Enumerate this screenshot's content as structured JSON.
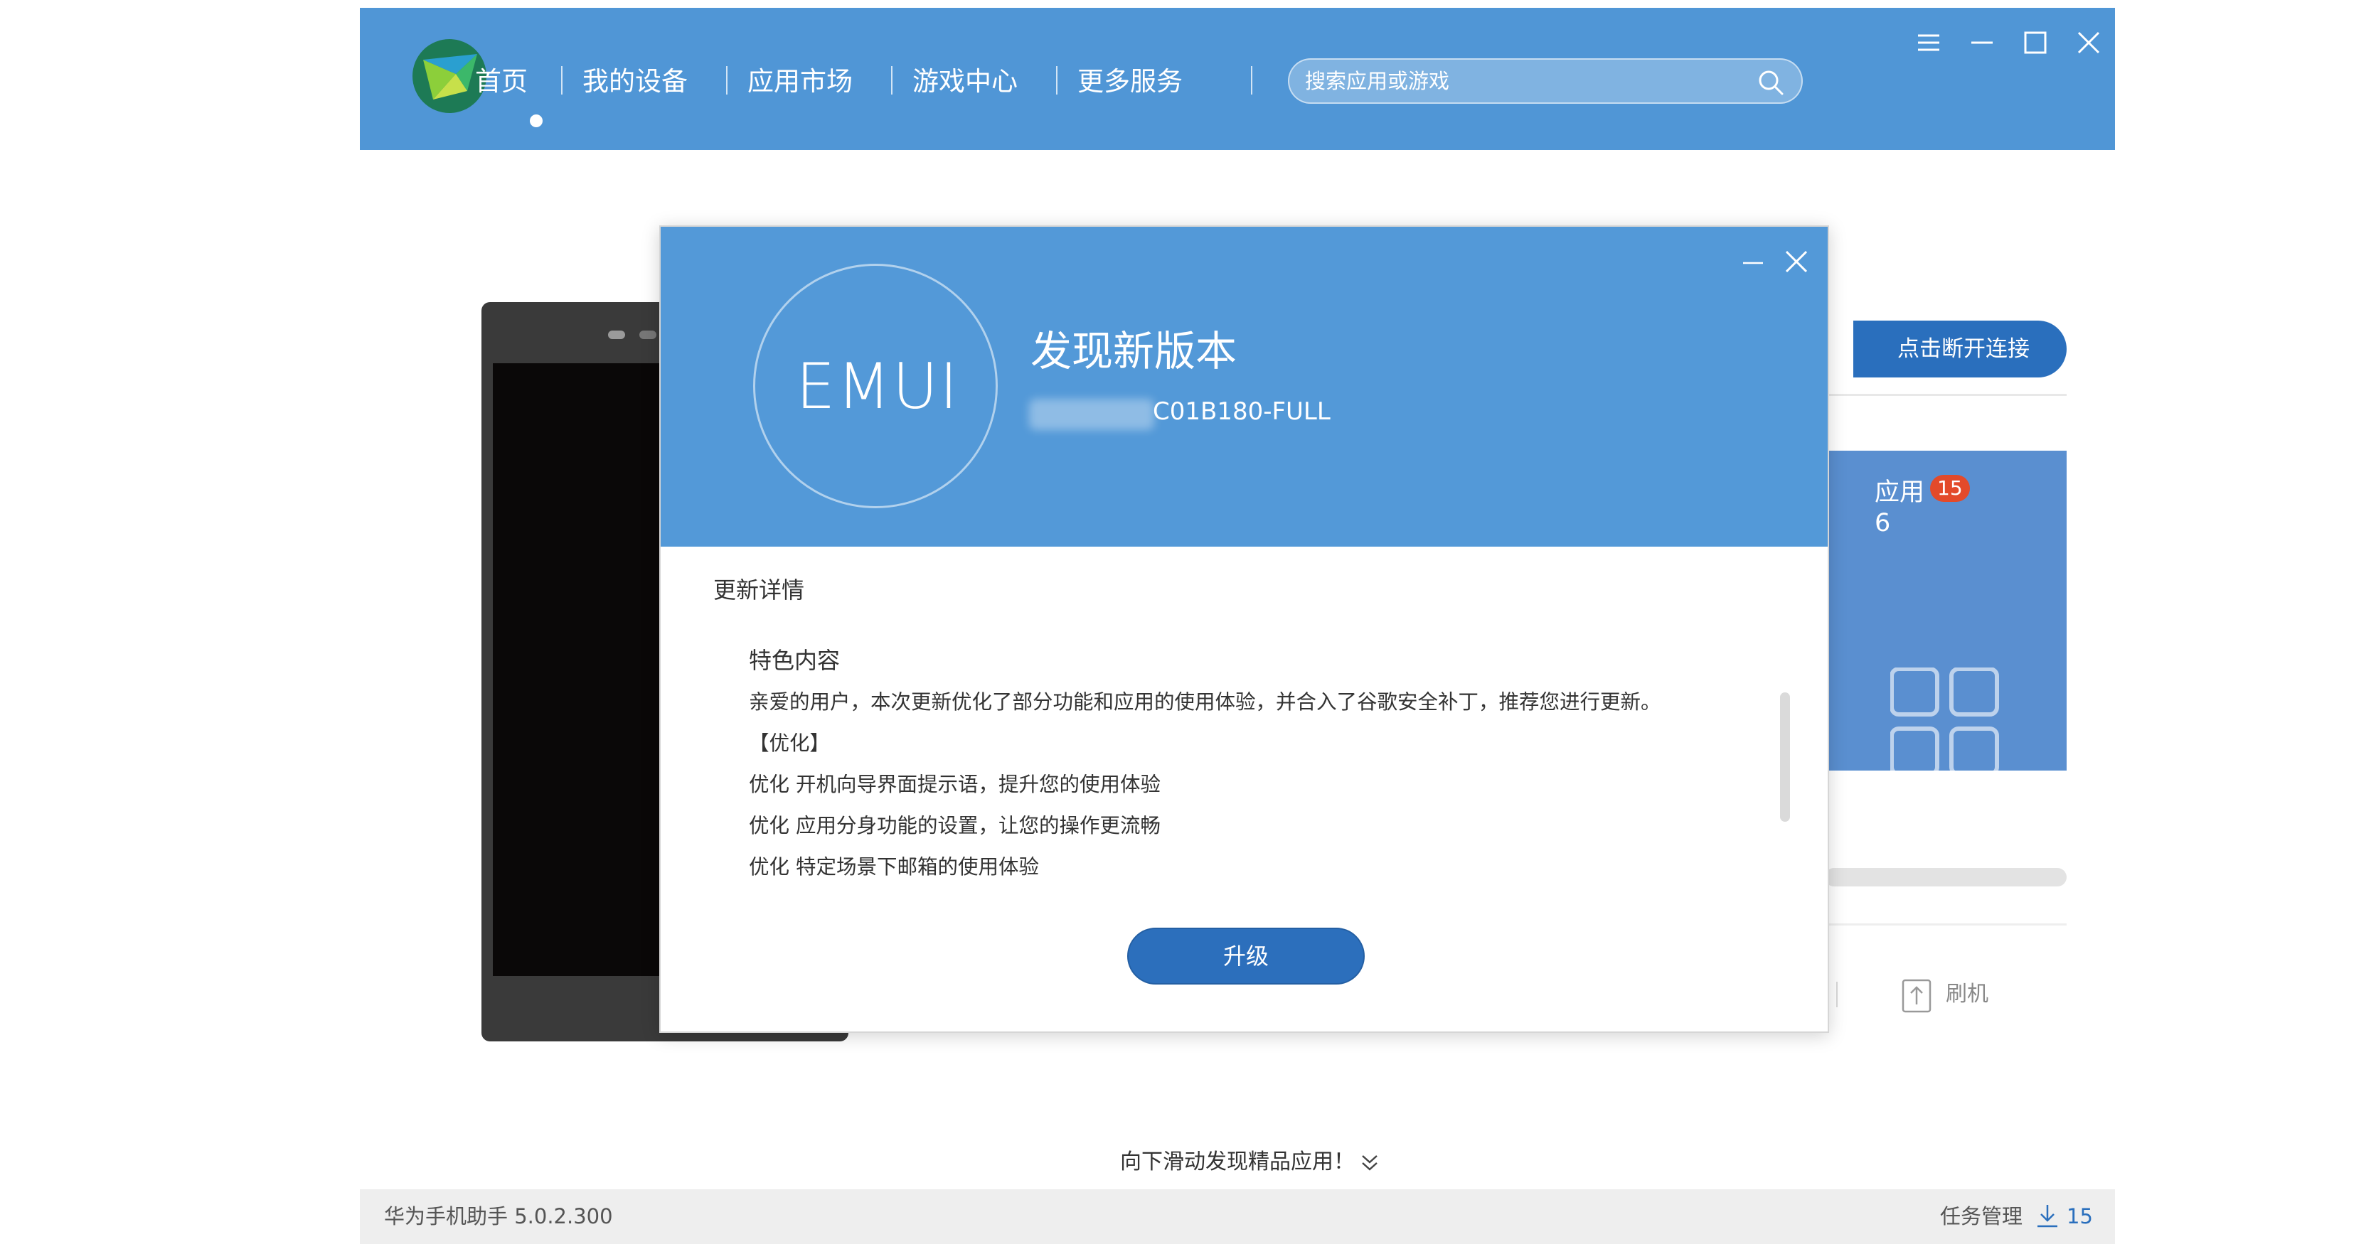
{
  "window": {
    "controls": {
      "menu_icon": "menu-icon",
      "minimize_icon": "minimize-icon",
      "maximize_icon": "maximize-icon",
      "close_icon": "close-icon"
    }
  },
  "nav": {
    "items": [
      {
        "label": "首页",
        "active": true
      },
      {
        "label": "我的设备",
        "active": false
      },
      {
        "label": "应用市场",
        "active": false
      },
      {
        "label": "游戏中心",
        "active": false
      },
      {
        "label": "更多服务",
        "active": false
      }
    ]
  },
  "search": {
    "placeholder": "搜索应用或游戏"
  },
  "device_panel": {
    "disconnect_label": "点击断开连接",
    "apps_tile_label": "应用",
    "apps_badge": "15",
    "apps_count_partial": "6",
    "flash_label": "刷机"
  },
  "scroll_hint": "向下滑动发现精品应用！",
  "statusbar": {
    "version": "华为手机助手 5.0.2.300",
    "task_label": "任务管理",
    "task_count": "15"
  },
  "dialog": {
    "logo_text": "EMUI",
    "title": "发现新版本",
    "version_suffix": "C01B180-FULL",
    "details_heading": "更新详情",
    "features_heading": "特色内容",
    "notes": [
      "亲爱的用户，本次更新优化了部分功能和应用的使用体验，并合入了谷歌安全补丁，推荐您进行更新。",
      "【优化】",
      "优化 开机向导界面提示语，提升您的使用体验",
      "优化 应用分身功能的设置，让您的操作更流畅",
      "优化 特定场景下邮箱的使用体验"
    ],
    "upgrade_label": "升级"
  },
  "colors": {
    "header_blue": "#5096d6",
    "dialog_blue": "#5399d8",
    "button_blue": "#2c6fbc",
    "badge_red": "#e34a2a"
  }
}
